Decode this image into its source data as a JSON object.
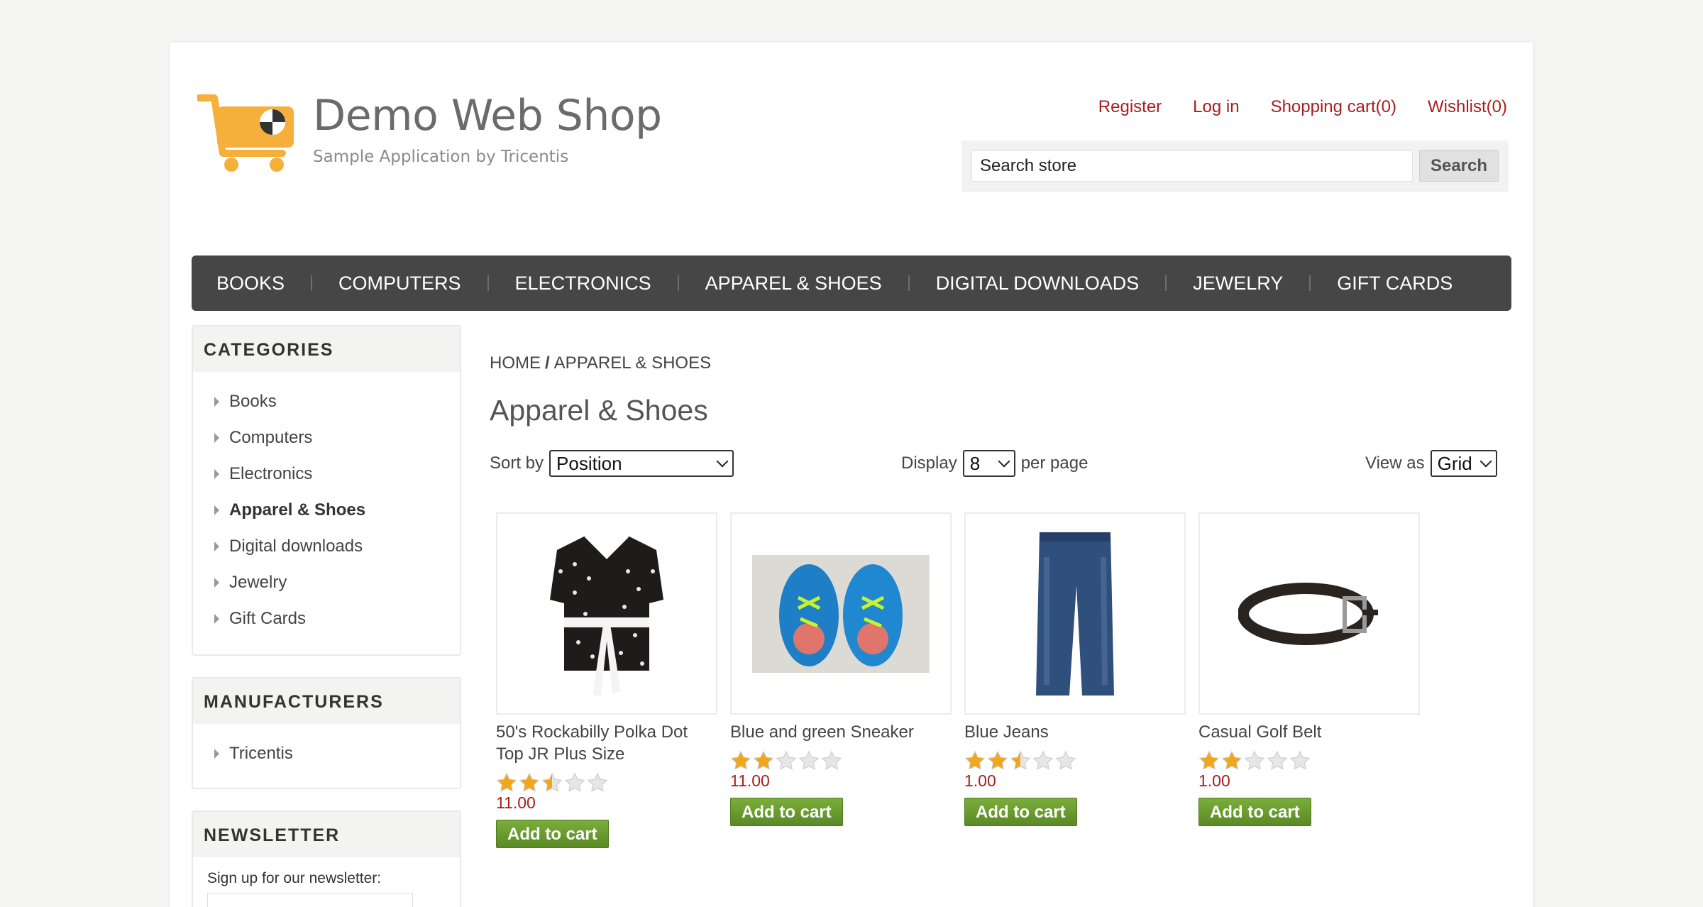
{
  "header": {
    "logo_title": "Demo Web Shop",
    "logo_subtitle": "Sample Application by Tricentis",
    "links": {
      "register": "Register",
      "login": "Log in",
      "cart": "Shopping cart(0)",
      "wishlist": "Wishlist(0)"
    },
    "search": {
      "value": "Search store",
      "button": "Search"
    }
  },
  "menu": [
    "BOOKS",
    "COMPUTERS",
    "ELECTRONICS",
    "APPAREL & SHOES",
    "DIGITAL DOWNLOADS",
    "JEWELRY",
    "GIFT CARDS"
  ],
  "sidebar": {
    "categories": {
      "title": "CATEGORIES",
      "items": [
        "Books",
        "Computers",
        "Electronics",
        "Apparel & Shoes",
        "Digital downloads",
        "Jewelry",
        "Gift Cards"
      ],
      "active": "Apparel & Shoes"
    },
    "manufacturers": {
      "title": "MANUFACTURERS",
      "items": [
        "Tricentis"
      ]
    },
    "newsletter": {
      "title": "NEWSLETTER",
      "label": "Sign up for our newsletter:"
    }
  },
  "main": {
    "breadcrumb": {
      "home": "HOME",
      "separator": "/",
      "current": "APPAREL & SHOES"
    },
    "title": "Apparel & Shoes",
    "sort": {
      "label": "Sort by",
      "value": "Position"
    },
    "display": {
      "label": "Display",
      "value": "8",
      "suffix": "per page"
    },
    "view": {
      "label": "View as",
      "value": "Grid"
    },
    "products": [
      {
        "name": "50's Rockabilly Polka Dot Top JR Plus Size",
        "rating": 2.5,
        "price": "11.00",
        "button": "Add to cart",
        "image": "polka-dot-top"
      },
      {
        "name": "Blue and green Sneaker",
        "rating": 2,
        "price": "11.00",
        "button": "Add to cart",
        "image": "sneaker"
      },
      {
        "name": "Blue Jeans",
        "rating": 2.5,
        "price": "1.00",
        "button": "Add to cart",
        "image": "jeans"
      },
      {
        "name": "Casual Golf Belt",
        "rating": 2,
        "price": "1.00",
        "button": "Add to cart",
        "image": "belt"
      }
    ]
  },
  "colors": {
    "accent_link": "#a91d1d",
    "menu_bg": "#464646",
    "button_green": "#6a9b30",
    "logo_orange": "#f5b03b"
  }
}
